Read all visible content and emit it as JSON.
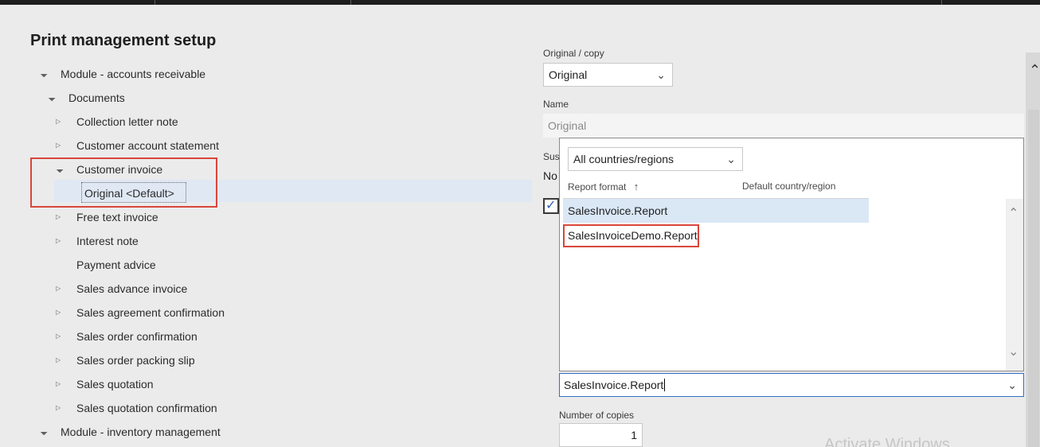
{
  "page": {
    "title": "Print management setup"
  },
  "tree": {
    "items": [
      {
        "label": "Module - accounts receivable",
        "expanded": true
      },
      {
        "label": "Documents",
        "expanded": true
      },
      {
        "label": "Collection letter note",
        "expanded": false
      },
      {
        "label": "Customer account statement",
        "expanded": false
      },
      {
        "label": "Customer invoice",
        "expanded": true
      },
      {
        "label": "Original <Default>",
        "selected": true
      },
      {
        "label": "Free text invoice",
        "expanded": false
      },
      {
        "label": "Interest note",
        "expanded": false
      },
      {
        "label": "Payment advice"
      },
      {
        "label": "Sales advance invoice",
        "expanded": false
      },
      {
        "label": "Sales agreement confirmation",
        "expanded": false
      },
      {
        "label": "Sales order confirmation",
        "expanded": false
      },
      {
        "label": "Sales order packing slip",
        "expanded": false
      },
      {
        "label": "Sales quotation",
        "expanded": false
      },
      {
        "label": "Sales quotation confirmation",
        "expanded": false
      },
      {
        "label": "Module - inventory management",
        "expanded": true
      }
    ]
  },
  "form": {
    "original_copy_label": "Original / copy",
    "original_copy_value": "Original",
    "name_label": "Name",
    "name_value": "Original",
    "suspend_label_partial": "Susp",
    "suspend_value_partial": "No",
    "report_format_value": "SalesInvoice.Report",
    "copies_label": "Number of copies",
    "copies_value": "1"
  },
  "popup": {
    "country_filter": "All countries/regions",
    "col_report_format": "Report format",
    "col_default_country": "Default country/region",
    "sort_icon": "arrow-up",
    "rows": [
      {
        "report_format": "SalesInvoice.Report",
        "selected": true
      },
      {
        "report_format": "SalesInvoiceDemo.Report",
        "highlighted": true
      }
    ]
  },
  "watermark": "Activate Windows",
  "colors": {
    "highlight_red": "#d9463b",
    "selection_blue": "#dfe8f3",
    "focus_border": "#2f6fc4"
  }
}
